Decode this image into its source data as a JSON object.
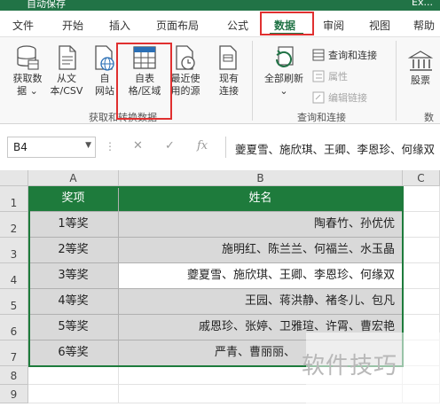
{
  "window": {
    "title_partial": "自动保存",
    "title_right_partial": "Ex..."
  },
  "tabs": [
    {
      "label": "文件"
    },
    {
      "label": "开始"
    },
    {
      "label": "插入"
    },
    {
      "label": "页面布局"
    },
    {
      "label": "公式"
    },
    {
      "label": "数据",
      "active": true
    },
    {
      "label": "审阅"
    },
    {
      "label": "视图"
    },
    {
      "label": "帮助"
    }
  ],
  "ribbon": {
    "get_transform": {
      "label": "获取和转换数据",
      "buttons": [
        {
          "line1": "获取数",
          "line2": "据 ⌄",
          "icon": "database-icon"
        },
        {
          "line1": "从文",
          "line2": "本/CSV",
          "icon": "text-file-icon"
        },
        {
          "line1": "自",
          "line2": "网站",
          "icon": "web-icon"
        },
        {
          "line1": "自表",
          "line2": "格/区域",
          "icon": "table-icon"
        },
        {
          "line1": "最近使",
          "line2": "用的源",
          "icon": "recent-sources-icon"
        },
        {
          "line1": "现有",
          "line2": "连接",
          "icon": "existing-connections-icon"
        }
      ]
    },
    "queries": {
      "label": "查询和连接",
      "refresh": {
        "line1": "全部刷新",
        "line2": "⌄",
        "icon": "refresh-all-icon"
      },
      "items": [
        {
          "label": "查询和连接",
          "icon": "queries-connections-icon",
          "enabled": true
        },
        {
          "label": "属性",
          "icon": "properties-icon",
          "enabled": false
        },
        {
          "label": "编辑链接",
          "icon": "edit-links-icon",
          "enabled": false
        }
      ]
    },
    "data_types": {
      "stocks": {
        "label": "股票",
        "icon": "stocks-icon"
      },
      "group_partial": "数"
    }
  },
  "formula_bar": {
    "name_box": "B4",
    "fx": "fx",
    "content": "夔夏雪、施欣琪、王卿、李恩珍、何缘双"
  },
  "sheet": {
    "columns": [
      "A",
      "B",
      "C"
    ],
    "rows": [
      "1",
      "2",
      "3",
      "4",
      "5",
      "6",
      "7",
      "8",
      "9"
    ],
    "header": {
      "award": "奖项",
      "names": "姓名"
    },
    "data": [
      {
        "award": "1等奖",
        "names": "陶春竹、孙优优"
      },
      {
        "award": "2等奖",
        "names": "施明红、陈兰兰、何福兰、水玉晶"
      },
      {
        "award": "3等奖",
        "names": "夔夏雪、施欣琪、王卿、李恩珍、何缘双"
      },
      {
        "award": "4等奖",
        "names": "王园、蒋洪静、褚冬儿、包凡"
      },
      {
        "award": "5等奖",
        "names": "戚恩珍、张婷、卫雅瑄、许霄、曹宏艳"
      },
      {
        "award": "6等奖",
        "names": "严青、曹丽丽、"
      }
    ],
    "selected_cell": "B4"
  },
  "watermark": "软件技巧",
  "colors": {
    "accent": "#217346",
    "header_fill": "#1e7b3c",
    "cell_fill": "#d9d9d9",
    "highlight": "#e03030"
  }
}
